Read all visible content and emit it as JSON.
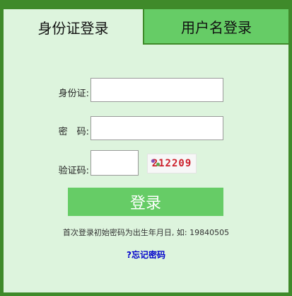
{
  "tabs": {
    "id_card_login": "身份证登录",
    "username_login": "用户名登录"
  },
  "form": {
    "id_label": "身份证:",
    "id_value": "",
    "password_label": "密　码:",
    "password_value": "",
    "captcha_label": "验证码:",
    "captcha_value": "",
    "captcha_code": "212209"
  },
  "actions": {
    "login_label": "登录",
    "forgot_label": "?忘记密码"
  },
  "hint": {
    "text": "首次登录初始密码为出生年月日, 如: 19840505"
  },
  "colors": {
    "frame": "#3f8a2a",
    "panel": "#ddf4dd",
    "accent": "#66cc66",
    "link": "#0000cc",
    "captcha_text": "#cc1f2a"
  }
}
